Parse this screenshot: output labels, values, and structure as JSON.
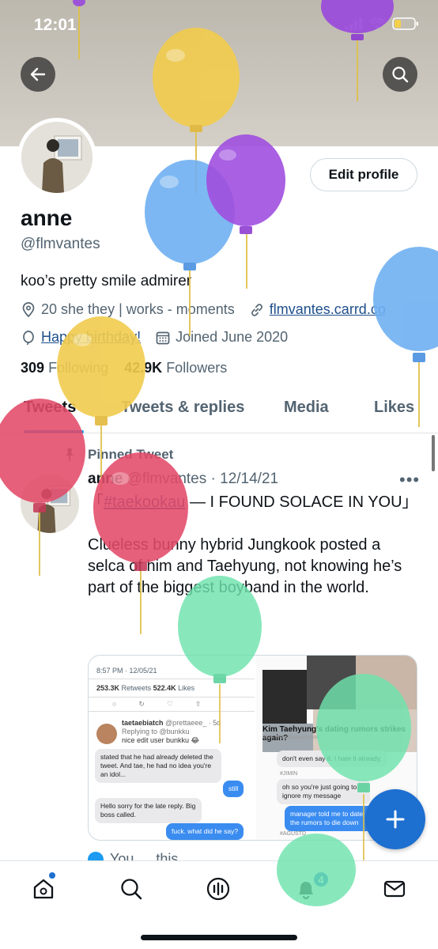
{
  "status_bar": {
    "time": "12:01"
  },
  "profile": {
    "name": "anne",
    "handle": "@flmvantes",
    "bio": "koo’s pretty smile admirer",
    "location": "20 she they | works - moments",
    "website": "flmvantes.carrd.co",
    "birthday": "Happy birthday!",
    "joined": "Joined June 2020",
    "following_count": "309",
    "following_label": "Following",
    "followers_count": "42.9K",
    "followers_label": "Followers",
    "edit_button": "Edit profile"
  },
  "tabs": [
    "Tweets",
    "Tweets & replies",
    "Media",
    "Likes"
  ],
  "pinned_tweet": {
    "pinned_label": "Pinned Tweet",
    "author": "anne",
    "handle": "@flmvantes",
    "date": "· 12/14/21",
    "more": "•••",
    "hashtag": "#taekookau",
    "text_line1": " — I FOUND SOLACE IN YOU」",
    "open_bracket": "「",
    "text_body": "Clueless bunny hybrid Jungkook posted a selca of him and Taehyung, not knowing he’s part of the biggest boyband in the world."
  },
  "media_left": {
    "time": "8:57 PM · 12/05/21",
    "retweets_count": "253.3K",
    "retweets_label": "Retweets",
    "likes_count": "522.4K",
    "likes_label": "Likes",
    "reply_name": "taetaebiatch",
    "reply_handle": "@prettaeee_ · 5d",
    "replying_to": "Replying to @bunkku",
    "reply_text": "nice edit user bunkku 😂",
    "msg1": "stated that he had already deleted the tweet. And tae, he had no idea you're an idol...",
    "msg2": "still",
    "msg3": "Hello sorry for the late reply. Big boss called.",
    "msg4": "fuck. what did he say?"
  },
  "media_right": {
    "headline": "Kim Taehyung's dating rumors strikes again?",
    "source": "visit: www.dispatch.com",
    "msg1": "don't even say it. I hate it already.",
    "tag1": "#JIMIN",
    "msg2": "oh so you're just going to ignore my message",
    "msg3": "manager told me to date the rumors to die down",
    "tag2": "#AGUSTD"
  },
  "next_tweet_text": "You … this",
  "notifications_badge": "4",
  "colors": {
    "accent": "#1d9bf0",
    "fab": "#1d6fd0",
    "link": "#1d4f8c"
  },
  "icons": [
    "back-arrow-icon",
    "search-icon",
    "location-icon",
    "link-icon",
    "balloon-icon",
    "calendar-icon",
    "pin-icon",
    "plus-icon",
    "home-icon",
    "spaces-icon",
    "bell-icon",
    "mail-icon"
  ]
}
